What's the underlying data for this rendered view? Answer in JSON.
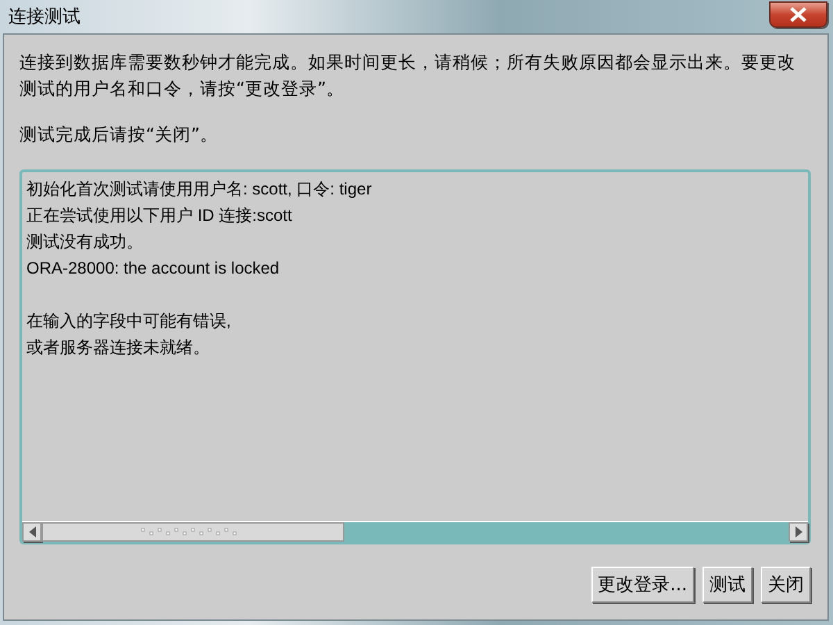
{
  "window": {
    "title": "连接测试"
  },
  "instructions": [
    "连接到数据库需要数秒钟才能完成。如果时间更长，请稍候；所有失败原因都会显示出来。要更改测试的用户名和口令，请按“更改登录”。",
    "测试完成后请按“关闭”。"
  ],
  "output_groups": [
    [
      "初始化首次测试请使用用户名: scott, 口令: tiger",
      "正在尝试使用以下用户 ID 连接:scott",
      "测试没有成功。",
      "ORA-28000: the account is locked"
    ],
    [
      "在输入的字段中可能有错误,",
      "或者服务器连接未就绪。"
    ]
  ],
  "buttons": [
    "更改登录...",
    "测试",
    "关闭"
  ]
}
